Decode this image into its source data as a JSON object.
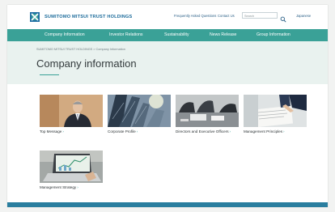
{
  "header": {
    "logo_text": "SUMITOMO MITSUI TRUST HOLDINGS",
    "links": [
      "Frequently Asked Questions",
      "Contact Us"
    ],
    "search_placeholder": "Search",
    "language": "Japanese"
  },
  "nav": {
    "items": [
      "Company Information",
      "Investor Relations",
      "Sustainability",
      "News Release",
      "Group Information"
    ]
  },
  "page": {
    "breadcrumb": "SUMITOMO MITSUI TRUST HOLDINGS > Company Information",
    "title": "Company information"
  },
  "cards": [
    {
      "label": "Top Message",
      "image": "portrait"
    },
    {
      "label": "Corporate Profile",
      "image": "buildings"
    },
    {
      "label": "Directors and Executive Officers",
      "image": "meeting"
    },
    {
      "label": "Management Principles",
      "image": "document"
    },
    {
      "label": "Management Strategy",
      "image": "laptop-chart"
    }
  ],
  "colors": {
    "accent": "#3aa197",
    "band": "#e9f2ef",
    "footer": "#2a7e9f"
  }
}
